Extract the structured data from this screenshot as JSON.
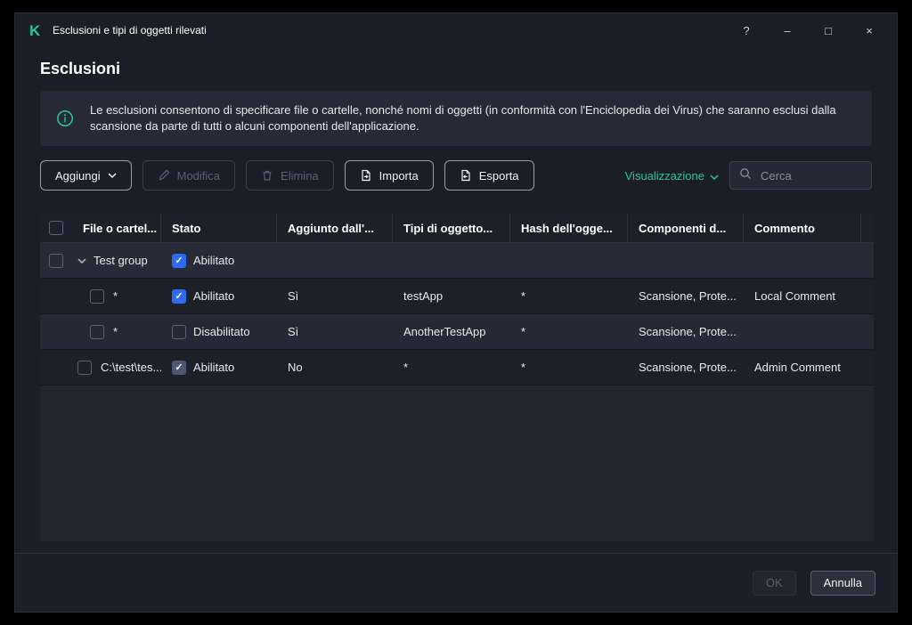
{
  "window": {
    "title": "Esclusioni e tipi di oggetti rilevati",
    "controls": {
      "help": "?",
      "minimize": "–",
      "maximize": "□",
      "close": "×"
    }
  },
  "page": {
    "title": "Esclusioni"
  },
  "banner": {
    "text": "Le esclusioni consentono di specificare file o cartelle, nonché nomi di oggetti (in conformità con l'Enciclopedia dei Virus) che saranno esclusi dalla scansione da parte di tutti o alcuni componenti dell'applicazione."
  },
  "toolbar": {
    "add_label": "Aggiungi",
    "edit_label": "Modifica",
    "delete_label": "Elimina",
    "import_label": "Importa",
    "export_label": "Esporta",
    "view_label": "Visualizzazione",
    "search_placeholder": "Cerca"
  },
  "table": {
    "columns": [
      "File o cartel...",
      "Stato",
      "Aggiunto dall'...",
      "Tipi di oggetto...",
      "Hash dell'ogge...",
      "Componenti d...",
      "Commento"
    ],
    "group": {
      "name": "Test group",
      "status_label": "Abilitato",
      "status_checked": true,
      "expanded": true
    },
    "rows": [
      {
        "file": "*",
        "status_label": "Abilitato",
        "status_checked": true,
        "status_muted": false,
        "added_by": "Sì",
        "object_types": "testApp",
        "hash": "*",
        "components": "Scansione, Prote...",
        "comment": "Local Comment",
        "in_group": true
      },
      {
        "file": "*",
        "status_label": "Disabilitato",
        "status_checked": false,
        "status_muted": false,
        "added_by": "Sì",
        "object_types": "AnotherTestApp",
        "hash": "*",
        "components": "Scansione, Prote...",
        "comment": "",
        "in_group": true
      },
      {
        "file": "C:\\test\\tes...",
        "status_label": "Abilitato",
        "status_checked": true,
        "status_muted": true,
        "added_by": "No",
        "object_types": "*",
        "hash": "*",
        "components": "Scansione, Prote...",
        "comment": "Admin Comment",
        "in_group": false
      }
    ]
  },
  "footer": {
    "ok_label": "OK",
    "cancel_label": "Annulla"
  },
  "colors": {
    "accent_green": "#27c79e",
    "checkbox_blue": "#2e6bf2",
    "checkbox_muted": "#4c5774"
  }
}
